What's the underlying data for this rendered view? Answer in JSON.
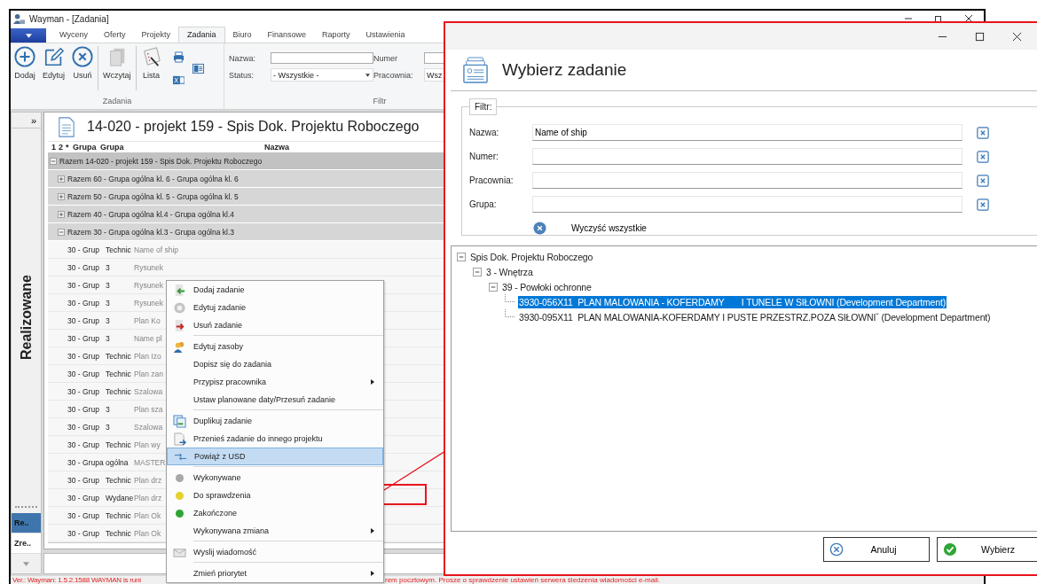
{
  "window": {
    "title": "Wayman - [Zadania]"
  },
  "ribbon_tabs": [
    {
      "label": "Wyceny",
      "selected": false
    },
    {
      "label": "Oferty",
      "selected": false
    },
    {
      "label": "Projekty",
      "selected": false
    },
    {
      "label": "Zadania",
      "selected": true
    },
    {
      "label": "Biuro",
      "selected": false
    },
    {
      "label": "Finansowe",
      "selected": false
    },
    {
      "label": "Raporty",
      "selected": false
    },
    {
      "label": "Ustawienia",
      "selected": false
    }
  ],
  "ribbon": {
    "task_group": {
      "label": "Zadania",
      "buttons": [
        {
          "label": "Dodaj"
        },
        {
          "label": "Edytuj"
        },
        {
          "label": "Usuń"
        },
        {
          "label": "Wczytaj"
        },
        {
          "label": "Lista"
        }
      ]
    },
    "filter_group": {
      "label": "Filtr",
      "fields": [
        {
          "label": "Nazwa:",
          "kind": "text"
        },
        {
          "label": "Numer",
          "kind": "text"
        },
        {
          "label": "Status:",
          "kind": "select",
          "value": "- Wszystkie -"
        },
        {
          "label": "Pracownia:",
          "kind": "select",
          "value": "Wsz"
        }
      ]
    }
  },
  "sidebar": {
    "collapse_label": "»",
    "title": "Realizowane",
    "tabs": [
      {
        "label": "Re..",
        "selected": true
      },
      {
        "label": "Zre..",
        "selected": false
      }
    ]
  },
  "main": {
    "title": "14-020 - projekt 159 - Spis Dok. Projektu Roboczego",
    "columns": [
      "1",
      "2",
      "*",
      "Grupa",
      "Grupa",
      "Nazwa"
    ],
    "rows": [
      {
        "kind": "group",
        "label": "Razem 14-020 - projekt 159 - Spis Dok. Projektu Roboczego",
        "expanded": true,
        "children": [
          {
            "kind": "group",
            "label": "Razem 60 - Grupa ogólna kl. 6 - Grupa ogólna kl. 6",
            "expanded": false
          },
          {
            "kind": "group",
            "label": "Razem 50 - Grupa ogólna kl. 5 - Grupa ogólna kl. 5",
            "expanded": false
          },
          {
            "kind": "group",
            "label": "Razem 40 - Grupa ogólna kl.4 - Grupa ogólna kl.4",
            "expanded": false
          },
          {
            "kind": "group",
            "label": "Razem 30 - Grupa ogólna kl.3 - Grupa ogólna kl.3",
            "expanded": true,
            "children": [
              {
                "kind": "task",
                "grupa": "30 - Grup",
                "grupa_2": "Technic",
                "nazwa": "Name of ship"
              },
              {
                "kind": "task",
                "grupa": "30 - Grup",
                "grupa_2": "3",
                "nazwa": "Rysunek"
              },
              {
                "kind": "task",
                "grupa": "30 - Grup",
                "grupa_2": "3",
                "nazwa": "Rysunek"
              },
              {
                "kind": "task",
                "grupa": "30 - Grup",
                "grupa_2": "3",
                "nazwa": "Rysunek"
              },
              {
                "kind": "task",
                "grupa": "30 - Grup",
                "grupa_2": "3",
                "nazwa": "Plan Ko"
              },
              {
                "kind": "task",
                "grupa": "30 - Grup",
                "grupa_2": "3",
                "nazwa": "Name pl"
              },
              {
                "kind": "task",
                "grupa": "30 - Grup",
                "grupa_2": "Technic",
                "nazwa": "Plan Izo"
              },
              {
                "kind": "task",
                "grupa": "30 - Grup",
                "grupa_2": "Technic",
                "nazwa": "Plan zan"
              },
              {
                "kind": "task",
                "grupa": "30 - Grup",
                "grupa_2": "Technic",
                "nazwa": "Szalowa"
              },
              {
                "kind": "task",
                "grupa": "30 - Grup",
                "grupa_2": "3",
                "nazwa": "Plan sza"
              },
              {
                "kind": "task",
                "grupa": "30 - Grup",
                "grupa_2": "3",
                "nazwa": "Szalowa"
              },
              {
                "kind": "task",
                "grupa": "30 - Grup",
                "grupa_2": "Technic",
                "nazwa": "Plan wy"
              },
              {
                "kind": "task",
                "grupa": "30 - Grupa",
                "grupa_2": "ogólna",
                "nazwa": "MASTER"
              },
              {
                "kind": "task",
                "grupa": "30 - Grup",
                "grupa_2": "Technic",
                "nazwa": "Plan drz"
              },
              {
                "kind": "task",
                "grupa": "30 - Grup",
                "grupa_2": "Wydane",
                "nazwa": "Plan drz"
              },
              {
                "kind": "task",
                "grupa": "30 - Grup",
                "grupa_2": "Technic",
                "nazwa": "Plan Ok"
              },
              {
                "kind": "task",
                "grupa": "30 - Grup",
                "grupa_2": "Technic",
                "nazwa": "Plan Ok"
              }
            ]
          }
        ]
      }
    ]
  },
  "context_menu": [
    {
      "kind": "command",
      "label": "Dodaj zadanie",
      "submenu": false,
      "highlighted": false
    },
    {
      "kind": "command",
      "label": "Edytuj zadanie",
      "submenu": false,
      "highlighted": false
    },
    {
      "kind": "command",
      "label": "Usuń zadanie",
      "submenu": false,
      "highlighted": false
    },
    {
      "kind": "separator"
    },
    {
      "kind": "command",
      "label": "Edytuj zasoby",
      "submenu": false,
      "highlighted": false
    },
    {
      "kind": "command",
      "label": "Dopisz się do zadania",
      "submenu": false,
      "highlighted": false
    },
    {
      "kind": "command",
      "label": "Przypisz pracownika",
      "submenu": true,
      "highlighted": false
    },
    {
      "kind": "command",
      "label": "Ustaw planowane daty/Przesuń zadanie",
      "submenu": false,
      "highlighted": false
    },
    {
      "kind": "separator"
    },
    {
      "kind": "command",
      "label": "Duplikuj zadanie",
      "submenu": false,
      "highlighted": false
    },
    {
      "kind": "command",
      "label": "Przenieś zadanie do innego projektu",
      "submenu": false,
      "highlighted": false
    },
    {
      "kind": "command",
      "label": "Powiąż z USD",
      "submenu": false,
      "highlighted": true
    },
    {
      "kind": "separator"
    },
    {
      "kind": "status",
      "label": "Wykonywane",
      "color": "#a8a8a8",
      "submenu": false,
      "highlighted": false
    },
    {
      "kind": "status",
      "label": "Do sprawdzenia",
      "color": "#e6d030",
      "submenu": false,
      "highlighted": false
    },
    {
      "kind": "status",
      "label": "Zakończone",
      "color": "#2fa535",
      "submenu": false,
      "highlighted": false
    },
    {
      "kind": "command",
      "label": "Wykonywana zmiana",
      "submenu": true,
      "highlighted": false
    },
    {
      "kind": "separator"
    },
    {
      "kind": "command",
      "label": "Wyslij wiadomość",
      "submenu": false,
      "highlighted": false
    },
    {
      "kind": "separator"
    },
    {
      "kind": "command",
      "label": "Zmień priorytet",
      "submenu": true,
      "highlighted": false
    }
  ],
  "status_bar": [
    "Ver.: Wayman: 1.5.2.1588 WAYMAN is runi",
    "rem pocztowym. Prosze o sprawdzenie ustawień serwera śledzenia wiadomości e-mail."
  ],
  "dialog": {
    "title": "Wybierz zadanie",
    "filter": {
      "legend": "Filtr:",
      "fields": [
        {
          "label": "Nazwa:",
          "value": "Name of ship"
        },
        {
          "label": "Numer:"
        },
        {
          "label": "Pracownia:"
        },
        {
          "label": "Grupa:"
        }
      ],
      "clear_all": "Wyczyść wszystkie"
    },
    "tree": [
      {
        "label": "Spis Dok. Projektu Roboczego",
        "expanded": true,
        "selected": false,
        "children": [
          {
            "label": "3 - Wnętrza",
            "expanded": true,
            "selected": false,
            "children": [
              {
                "label": "39 - Powłoki ochronne",
                "expanded": true,
                "selected": false,
                "children": [
                  {
                    "label": "3930-056X11  PLAN MALOWANIA - KOFERDAMY       I TUNELE W SIŁOWNI (Development Department)",
                    "selected": true
                  },
                  {
                    "label": "3930-095X11  PLAN MALOWANIA-KOFERDAMY I PUSTE PRZESTRZ.POZA SIŁOWNIˇ (Development Department)",
                    "selected": false
                  }
                ]
              }
            ]
          }
        ]
      }
    ],
    "buttons": [
      {
        "label": "Anuluj",
        "kind": "cancel"
      },
      {
        "label": "Wybierz",
        "kind": "ok"
      }
    ]
  }
}
